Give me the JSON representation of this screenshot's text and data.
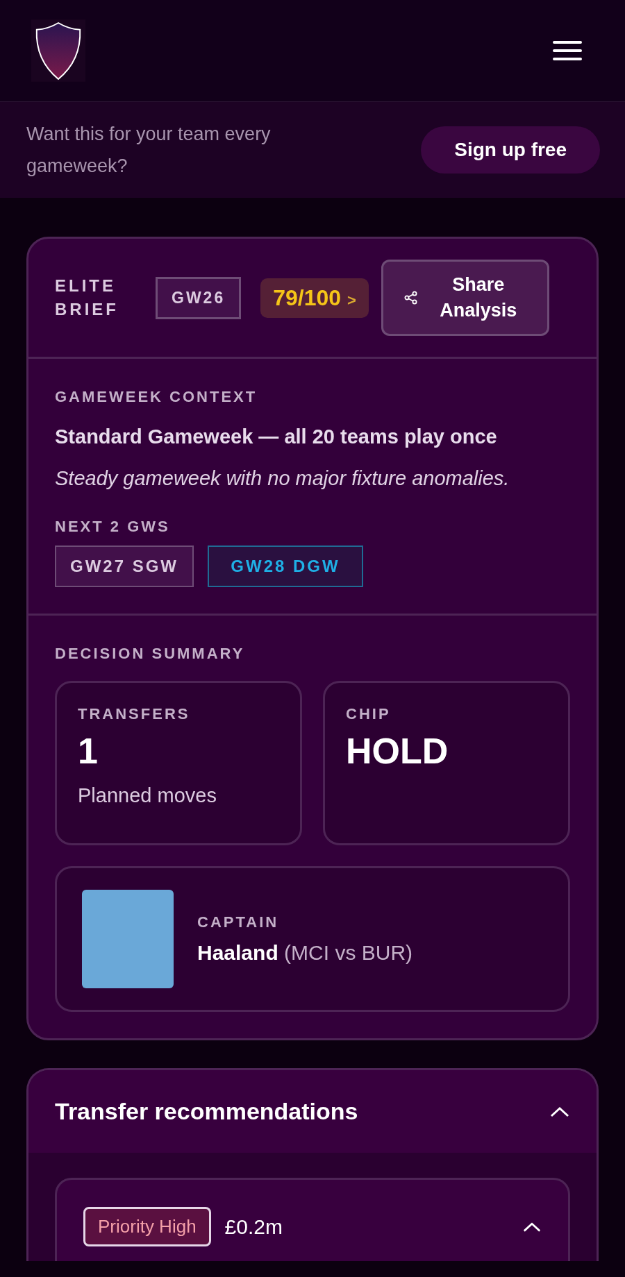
{
  "banner": {
    "text": "Want this for your team every gameweek?",
    "button": "Sign up free"
  },
  "brief": {
    "title": "ELITE BRIEF",
    "gameweek": "GW26",
    "score": "79/100",
    "score_caret": ">",
    "share": "Share Analysis",
    "context": {
      "label": "GAMEWEEK CONTEXT",
      "headline": "Standard Gameweek — all 20 teams play once",
      "note": "Steady gameweek with no major fixture anomalies.",
      "next_label": "NEXT 2 GWS",
      "next_gws": [
        {
          "label": "GW27 SGW",
          "kind": "single"
        },
        {
          "label": "GW28 DGW",
          "kind": "double"
        }
      ]
    },
    "summary": {
      "label": "DECISION SUMMARY",
      "transfers": {
        "label": "TRANSFERS",
        "value": "1",
        "caption": "Planned moves"
      },
      "chip": {
        "label": "CHIP",
        "value": "HOLD"
      },
      "captain": {
        "label": "CAPTAIN",
        "name": "Haaland",
        "fixture": "(MCI vs BUR)"
      }
    }
  },
  "transfers": {
    "title": "Transfer recommendations",
    "expanded": true,
    "items": [
      {
        "priority": "Priority High",
        "cost": "£0.2m",
        "expanded": true
      }
    ]
  }
}
